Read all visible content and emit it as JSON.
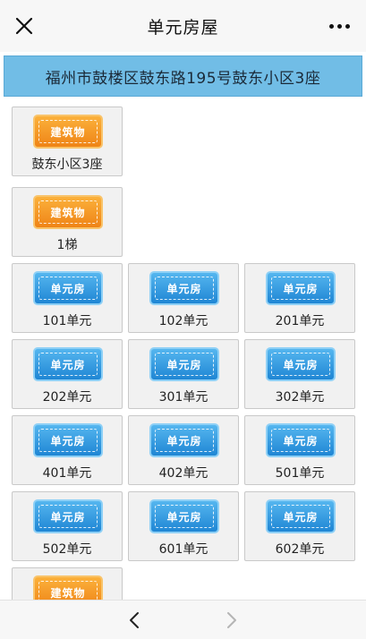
{
  "nav": {
    "title": "单元房屋"
  },
  "address": "福州市鼓楼区鼓东路195号鼓东小区3座",
  "badges": {
    "building": "建筑物",
    "unit": "单元房"
  },
  "colors": {
    "banner": "#71bde6",
    "building_badge": "#f39a24",
    "unit_badge": "#2d95dd"
  },
  "cards": [
    {
      "label": "鼓东小区3座"
    },
    {
      "label": "1梯"
    },
    {
      "label": "101单元"
    },
    {
      "label": "102单元"
    },
    {
      "label": "201单元"
    },
    {
      "label": "202单元"
    },
    {
      "label": "301单元"
    },
    {
      "label": "302单元"
    },
    {
      "label": "401单元"
    },
    {
      "label": "402单元"
    },
    {
      "label": "501单元"
    },
    {
      "label": "502单元"
    },
    {
      "label": "601单元"
    },
    {
      "label": "602单元"
    }
  ],
  "icons": {
    "close": "close-icon",
    "more": "more-icon",
    "back": "chevron-left-icon",
    "forward": "chevron-right-icon"
  }
}
